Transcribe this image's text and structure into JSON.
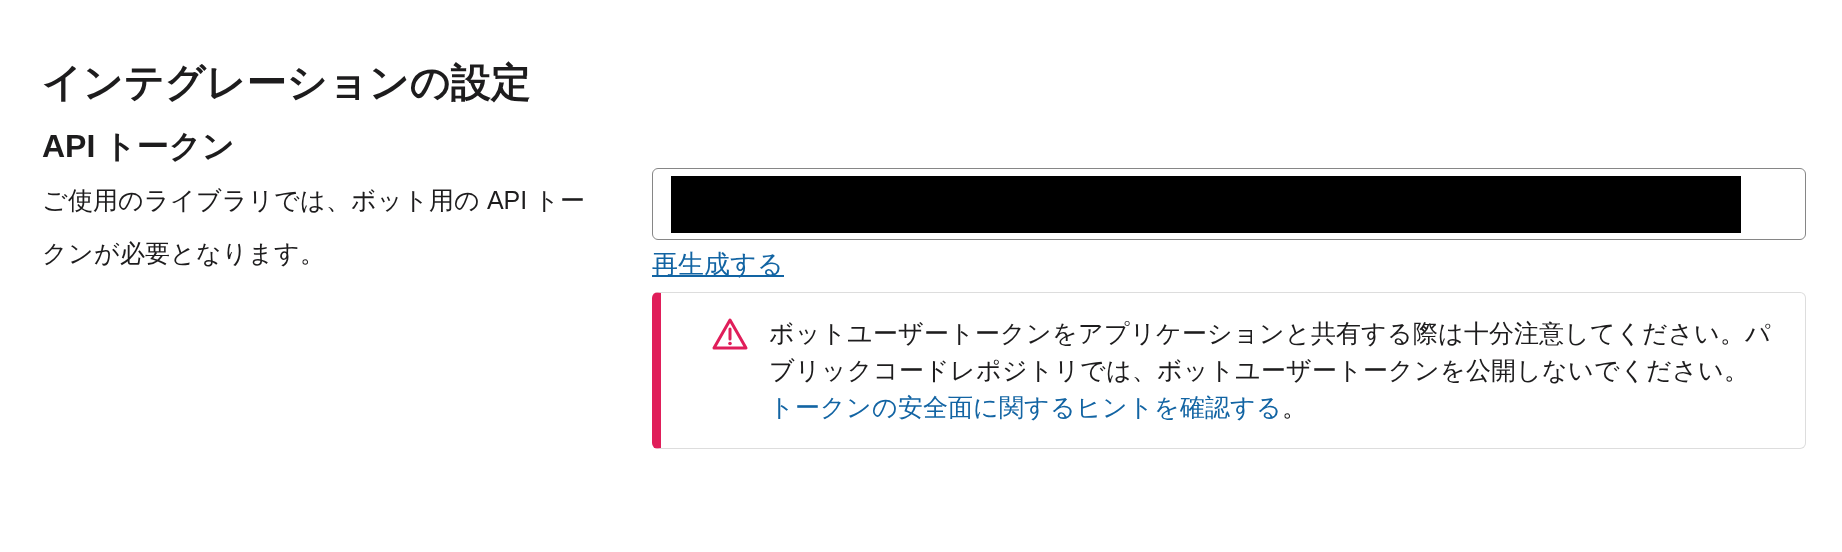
{
  "title": "インテグレーションの設定",
  "section": {
    "heading": "API トークン",
    "description": "ご使用のライブラリでは、ボット用の API トークンが必要となります。",
    "token_field": {
      "redacted": true
    },
    "regenerate_link": "再生成する",
    "warning": {
      "text": "ボットユーザートークンをアプリケーションと共有する際は十分注意してください。パブリックコードレポジトリでは、ボットユーザートークンを公開しないでください。",
      "link": "トークンの安全面に関するヒントを確認する",
      "suffix": "。"
    }
  }
}
